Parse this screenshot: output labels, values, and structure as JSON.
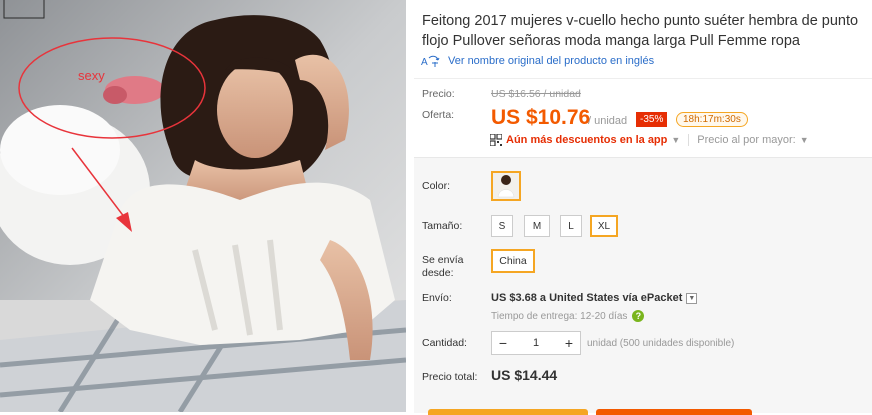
{
  "product": {
    "title": "Feitong 2017 mujeres v-cuello hecho punto suéter hembra de punto flojo Pullover señoras moda manga larga Pull Femme ropa",
    "translate_link": "Ver nombre original del producto en inglés",
    "image_annotation": "sexy"
  },
  "price": {
    "label_price": "Precio:",
    "old_price": "US $16.56 / unidad",
    "label_offer": "Oferta:",
    "offer_price": "US $10.76",
    "unit": "/ unidad",
    "discount": "-35%",
    "timer": "18h:17m:30s",
    "app_discount": "Aún más descuentos en la app",
    "wholesale": "Precio al por mayor:"
  },
  "options": {
    "color_label": "Color:",
    "size_label": "Tamaño:",
    "sizes": [
      "S",
      "M",
      "L",
      "XL"
    ],
    "selected_size": "XL",
    "ships_from_label": "Se envía desde:",
    "ships_from": "China",
    "shipping_label": "Envío:",
    "shipping_text": "US $3.68 a United States vía ePacket",
    "delivery_text": "Tiempo de entrega:  12-20  días",
    "qty_label": "Cantidad:",
    "qty_minus": "−",
    "qty_value": "1",
    "qty_plus": "+",
    "qty_note": "unidad (500 unidades disponible)",
    "total_label": "Precio total:",
    "total_value": "US $14.44"
  },
  "colors": {
    "accent": "#f35a00",
    "discount_bg": "#e62e04",
    "selected_border": "#f5a623",
    "link": "#2a6dc9"
  }
}
